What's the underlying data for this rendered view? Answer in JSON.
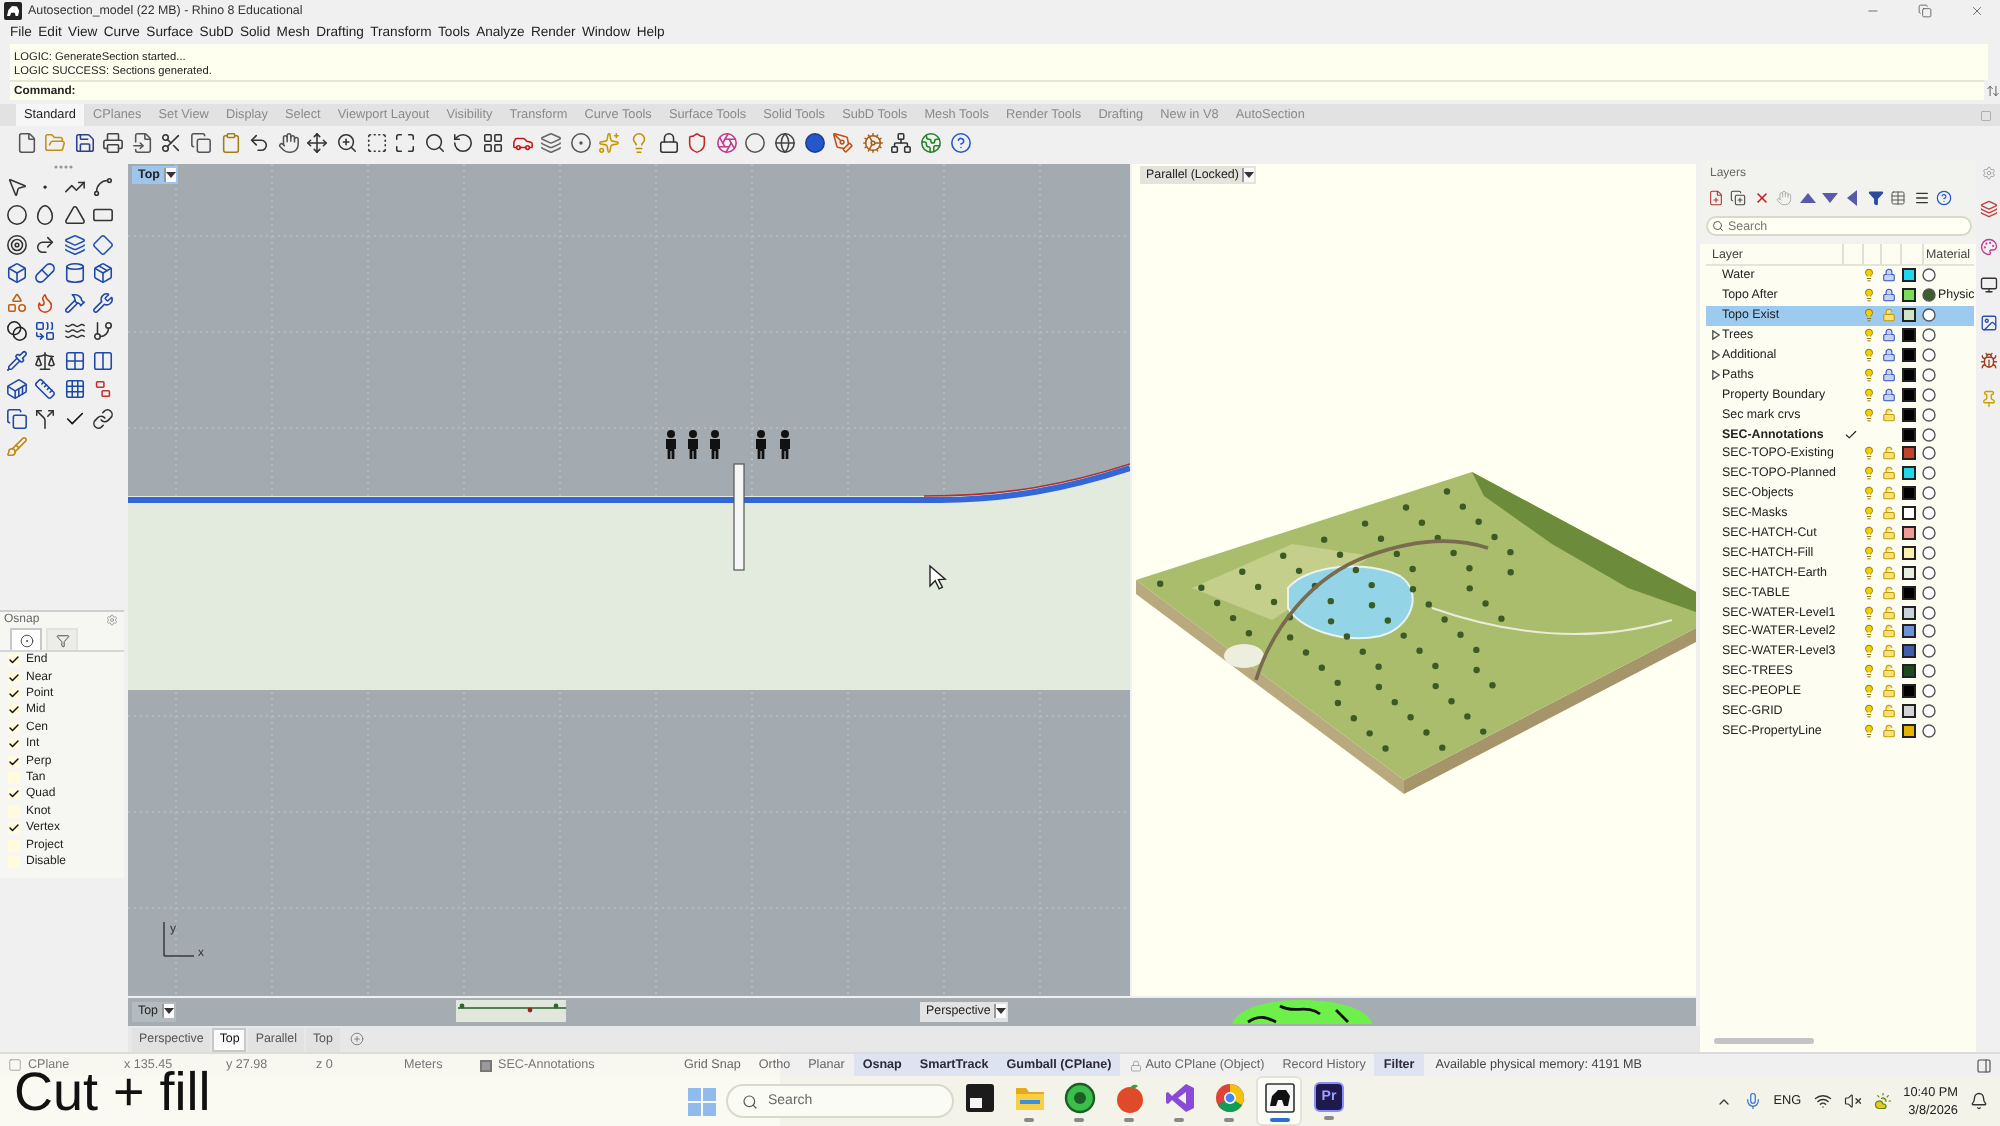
{
  "window": {
    "title": "Autosection_model (22 MB) - Rhino 8 Educational"
  },
  "menu": [
    "File",
    "Edit",
    "View",
    "Curve",
    "Surface",
    "SubD",
    "Solid",
    "Mesh",
    "Drafting",
    "Transform",
    "Tools",
    "Analyze",
    "Render",
    "Window",
    "Help"
  ],
  "command": {
    "history": [
      "LOGIC: GenerateSection started...",
      "LOGIC SUCCESS: Sections generated."
    ],
    "prompt": "Command:"
  },
  "toolbar_tabs": [
    {
      "label": "Standard",
      "selected": true
    },
    {
      "label": "CPlanes",
      "selected": false
    },
    {
      "label": "Set View",
      "selected": false
    },
    {
      "label": "Display",
      "selected": false
    },
    {
      "label": "Select",
      "selected": false
    },
    {
      "label": "Viewport Layout",
      "selected": false
    },
    {
      "label": "Visibility",
      "selected": false
    },
    {
      "label": "Transform",
      "selected": false
    },
    {
      "label": "Curve Tools",
      "selected": false
    },
    {
      "label": "Surface Tools",
      "selected": false
    },
    {
      "label": "Solid Tools",
      "selected": false
    },
    {
      "label": "SubD Tools",
      "selected": false
    },
    {
      "label": "Mesh Tools",
      "selected": false
    },
    {
      "label": "Render Tools",
      "selected": false
    },
    {
      "label": "Drafting",
      "selected": false
    },
    {
      "label": "New in V8",
      "selected": false
    },
    {
      "label": "AutoSection",
      "selected": false
    }
  ],
  "osnap": {
    "title": "Osnap",
    "tabs": [
      {
        "kind": "snaps",
        "selected": true
      },
      {
        "kind": "filter",
        "selected": false
      }
    ],
    "items": [
      {
        "label": "End",
        "checked": true
      },
      {
        "label": "Near",
        "checked": true
      },
      {
        "label": "Point",
        "checked": true
      },
      {
        "label": "Mid",
        "checked": true
      },
      {
        "label": "Cen",
        "checked": true
      },
      {
        "label": "Int",
        "checked": true
      },
      {
        "label": "Perp",
        "checked": true
      },
      {
        "label": "Tan",
        "checked": false
      },
      {
        "label": "Quad",
        "checked": true
      },
      {
        "label": "Knot",
        "checked": false
      },
      {
        "label": "Vertex",
        "checked": true
      },
      {
        "label": "Project",
        "checked": false
      },
      {
        "label": "Disable",
        "checked": false
      }
    ]
  },
  "viewports": [
    {
      "kind": "top",
      "title": "Top",
      "active": true
    },
    {
      "kind": "parallel",
      "title": "Parallel (Locked)",
      "active": false
    }
  ],
  "axes": {
    "x": "x",
    "y": "y"
  },
  "minimized_viewports": [
    {
      "kind": "top",
      "title": "Top"
    },
    {
      "kind": "perspective",
      "title": "Perspective"
    }
  ],
  "viewport_tabs": [
    {
      "label": "Perspective",
      "selected": false
    },
    {
      "label": "Top",
      "selected": true
    },
    {
      "label": "Parallel",
      "selected": false
    },
    {
      "label": "Top",
      "selected": false
    }
  ],
  "layers": {
    "title": "Layers",
    "search": {
      "placeholder": "Search"
    },
    "columns": [
      "Layer",
      "Material"
    ],
    "rows": [
      {
        "name": "Water",
        "selected": false,
        "current": false,
        "collapsed": false,
        "visible": true,
        "locked": true,
        "color": "#22d6ec"
      },
      {
        "name": "Topo After",
        "selected": false,
        "current": false,
        "collapsed": false,
        "visible": true,
        "locked": true,
        "color": "#7cdc5c",
        "material": {
          "label": "Physic",
          "color": "#3d5f2a"
        }
      },
      {
        "name": "Topo Exist",
        "selected": true,
        "current": false,
        "collapsed": false,
        "visible": true,
        "locked": false,
        "color": "#cfe6c6"
      },
      {
        "name": "Trees",
        "selected": false,
        "current": false,
        "collapsed": true,
        "visible": true,
        "locked": true,
        "color": "#000000"
      },
      {
        "name": "Additional",
        "selected": false,
        "current": false,
        "collapsed": true,
        "visible": true,
        "locked": true,
        "color": "#000000"
      },
      {
        "name": "Paths",
        "selected": false,
        "current": false,
        "collapsed": true,
        "visible": true,
        "locked": true,
        "color": "#000000"
      },
      {
        "name": "Property Boundary",
        "selected": false,
        "current": false,
        "collapsed": false,
        "visible": true,
        "locked": true,
        "color": "#000000"
      },
      {
        "name": "Sec mark crvs",
        "selected": false,
        "current": false,
        "collapsed": false,
        "visible": true,
        "locked": false,
        "color": "#000000"
      },
      {
        "name": "SEC-Annotations",
        "selected": false,
        "current": true,
        "collapsed": false,
        "color": "#000000"
      },
      {
        "name": "SEC-TOPO-Existing",
        "selected": false,
        "current": false,
        "collapsed": false,
        "visible": true,
        "locked": false,
        "color": "#c0442a"
      },
      {
        "name": "SEC-TOPO-Planned",
        "selected": false,
        "current": false,
        "collapsed": false,
        "visible": true,
        "locked": false,
        "color": "#22d6ec"
      },
      {
        "name": "SEC-Objects",
        "selected": false,
        "current": false,
        "collapsed": false,
        "visible": true,
        "locked": false,
        "color": "#000000"
      },
      {
        "name": "SEC-Masks",
        "selected": false,
        "current": false,
        "collapsed": false,
        "visible": true,
        "locked": false,
        "color": "#ffffff"
      },
      {
        "name": "SEC-HATCH-Cut",
        "selected": false,
        "current": false,
        "collapsed": false,
        "visible": true,
        "locked": false,
        "color": "#f29a94"
      },
      {
        "name": "SEC-HATCH-Fill",
        "selected": false,
        "current": false,
        "collapsed": false,
        "visible": true,
        "locked": false,
        "color": "#fcefb4"
      },
      {
        "name": "SEC-HATCH-Earth",
        "selected": false,
        "current": false,
        "collapsed": false,
        "visible": true,
        "locked": false,
        "color": "#e6efe0"
      },
      {
        "name": "SEC-TABLE",
        "selected": false,
        "current": false,
        "collapsed": false,
        "visible": true,
        "locked": false,
        "color": "#000000"
      },
      {
        "name": "SEC-WATER-Level1",
        "selected": false,
        "current": false,
        "collapsed": false,
        "visible": true,
        "locked": false,
        "color": "#c9d3de"
      },
      {
        "name": "SEC-WATER-Level2",
        "selected": false,
        "current": false,
        "collapsed": false,
        "visible": true,
        "locked": false,
        "color": "#6b93dc"
      },
      {
        "name": "SEC-WATER-Level3",
        "selected": false,
        "current": false,
        "collapsed": false,
        "visible": true,
        "locked": false,
        "color": "#3f5fae"
      },
      {
        "name": "SEC-TREES",
        "selected": false,
        "current": false,
        "collapsed": false,
        "visible": true,
        "locked": false,
        "color": "#1e4a1e"
      },
      {
        "name": "SEC-PEOPLE",
        "selected": false,
        "current": false,
        "collapsed": false,
        "visible": true,
        "locked": false,
        "color": "#000000"
      },
      {
        "name": "SEC-GRID",
        "selected": false,
        "current": false,
        "collapsed": false,
        "visible": true,
        "locked": false,
        "color": "#d4d4d4"
      },
      {
        "name": "SEC-PropertyLine",
        "selected": false,
        "current": false,
        "collapsed": false,
        "visible": true,
        "locked": false,
        "color": "#e4b400"
      }
    ]
  },
  "status_bar": {
    "cplane": "CPlane",
    "coordinates": [
      "x 135.45",
      "y 27.98",
      "z 0"
    ],
    "units": "Meters",
    "layer": "SEC-Annotations",
    "toggles": [
      {
        "label": "Grid Snap",
        "on": false,
        "kind": "plain"
      },
      {
        "label": "Ortho",
        "on": false,
        "kind": "plain"
      },
      {
        "label": "Planar",
        "on": false,
        "kind": "plain"
      },
      {
        "label": "Osnap",
        "on": true,
        "kind": "plain"
      },
      {
        "label": "SmartTrack",
        "on": true,
        "kind": "plain"
      },
      {
        "label": "Gumball (CPlane)",
        "on": true,
        "kind": "plain"
      },
      {
        "label": "Auto CPlane (Object)",
        "on": false,
        "kind": "lock"
      },
      {
        "label": "Record History",
        "on": false,
        "kind": "plain"
      },
      {
        "label": "Filter",
        "on": true,
        "kind": "plain"
      }
    ],
    "memory": "Available physical memory: 4191 MB"
  },
  "taskbar": {
    "search": {
      "placeholder": "Search"
    },
    "apps": [
      {
        "kind": "widget",
        "running": false,
        "active": false
      },
      {
        "kind": "folder",
        "running": true,
        "active": false
      },
      {
        "kind": "game",
        "running": true,
        "active": false
      },
      {
        "kind": "paint",
        "running": true,
        "active": false
      },
      {
        "kind": "studio",
        "running": true,
        "active": false
      },
      {
        "kind": "browser",
        "running": true,
        "active": false
      },
      {
        "kind": "modeler",
        "running": true,
        "active": true
      },
      {
        "kind": "video",
        "label": "Pr",
        "running": true,
        "active": false
      }
    ],
    "language": "ENG",
    "time": "10:40 PM",
    "date": "3/8/2026"
  },
  "caption": "Cut + fill"
}
